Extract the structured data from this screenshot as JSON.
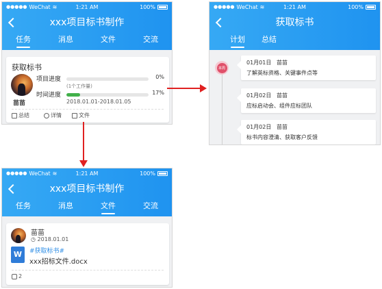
{
  "status": {
    "carrier": "WeChat",
    "time": "1:21 AM",
    "battery": "100%"
  },
  "screen1": {
    "title": "xxx项目标书制作",
    "tabs": [
      "任务",
      "消息",
      "文件",
      "交流"
    ],
    "task_card": {
      "heading": "获取标书",
      "user": "苗苗",
      "project_progress_label": "项目进度",
      "project_progress_pct": "0%",
      "project_progress_value": 0,
      "workload_note": "(1个工作量)",
      "time_progress_label": "时间进度",
      "time_progress_pct": "17%",
      "time_progress_value": 0.17,
      "date_range": "2018.01.01-2018.01.05",
      "actions": [
        "总结",
        "详情",
        "文件"
      ]
    }
  },
  "screen2": {
    "title": "获取标书",
    "tabs": [
      "计划",
      "总结"
    ],
    "week_badge": "本周",
    "entries": [
      {
        "date": "01月01日",
        "user": "苗苗",
        "text": "了解英标资格、关键事件点等"
      },
      {
        "date": "01月02日",
        "user": "苗苗",
        "text": "应标启动会、组件应标团队"
      },
      {
        "date": "01月02日",
        "user": "苗苗",
        "text": "标书内容澄清、获取客户反馈"
      }
    ]
  },
  "screen3": {
    "title": "xxx项目标书制作",
    "tabs": [
      "任务",
      "消息",
      "文件",
      "交流"
    ],
    "file_card": {
      "user": "苗苗",
      "date": "2018.01.01",
      "tag": "#获取标书#",
      "filename": "xxx招标文件.docx",
      "file_icon_letter": "W",
      "comment_count": "2"
    }
  },
  "colors": {
    "header_start": "#36a9f4",
    "header_end": "#1f93f0",
    "progress": "#41b04a",
    "arrow": "#e02020",
    "badge": "#e0506a"
  }
}
